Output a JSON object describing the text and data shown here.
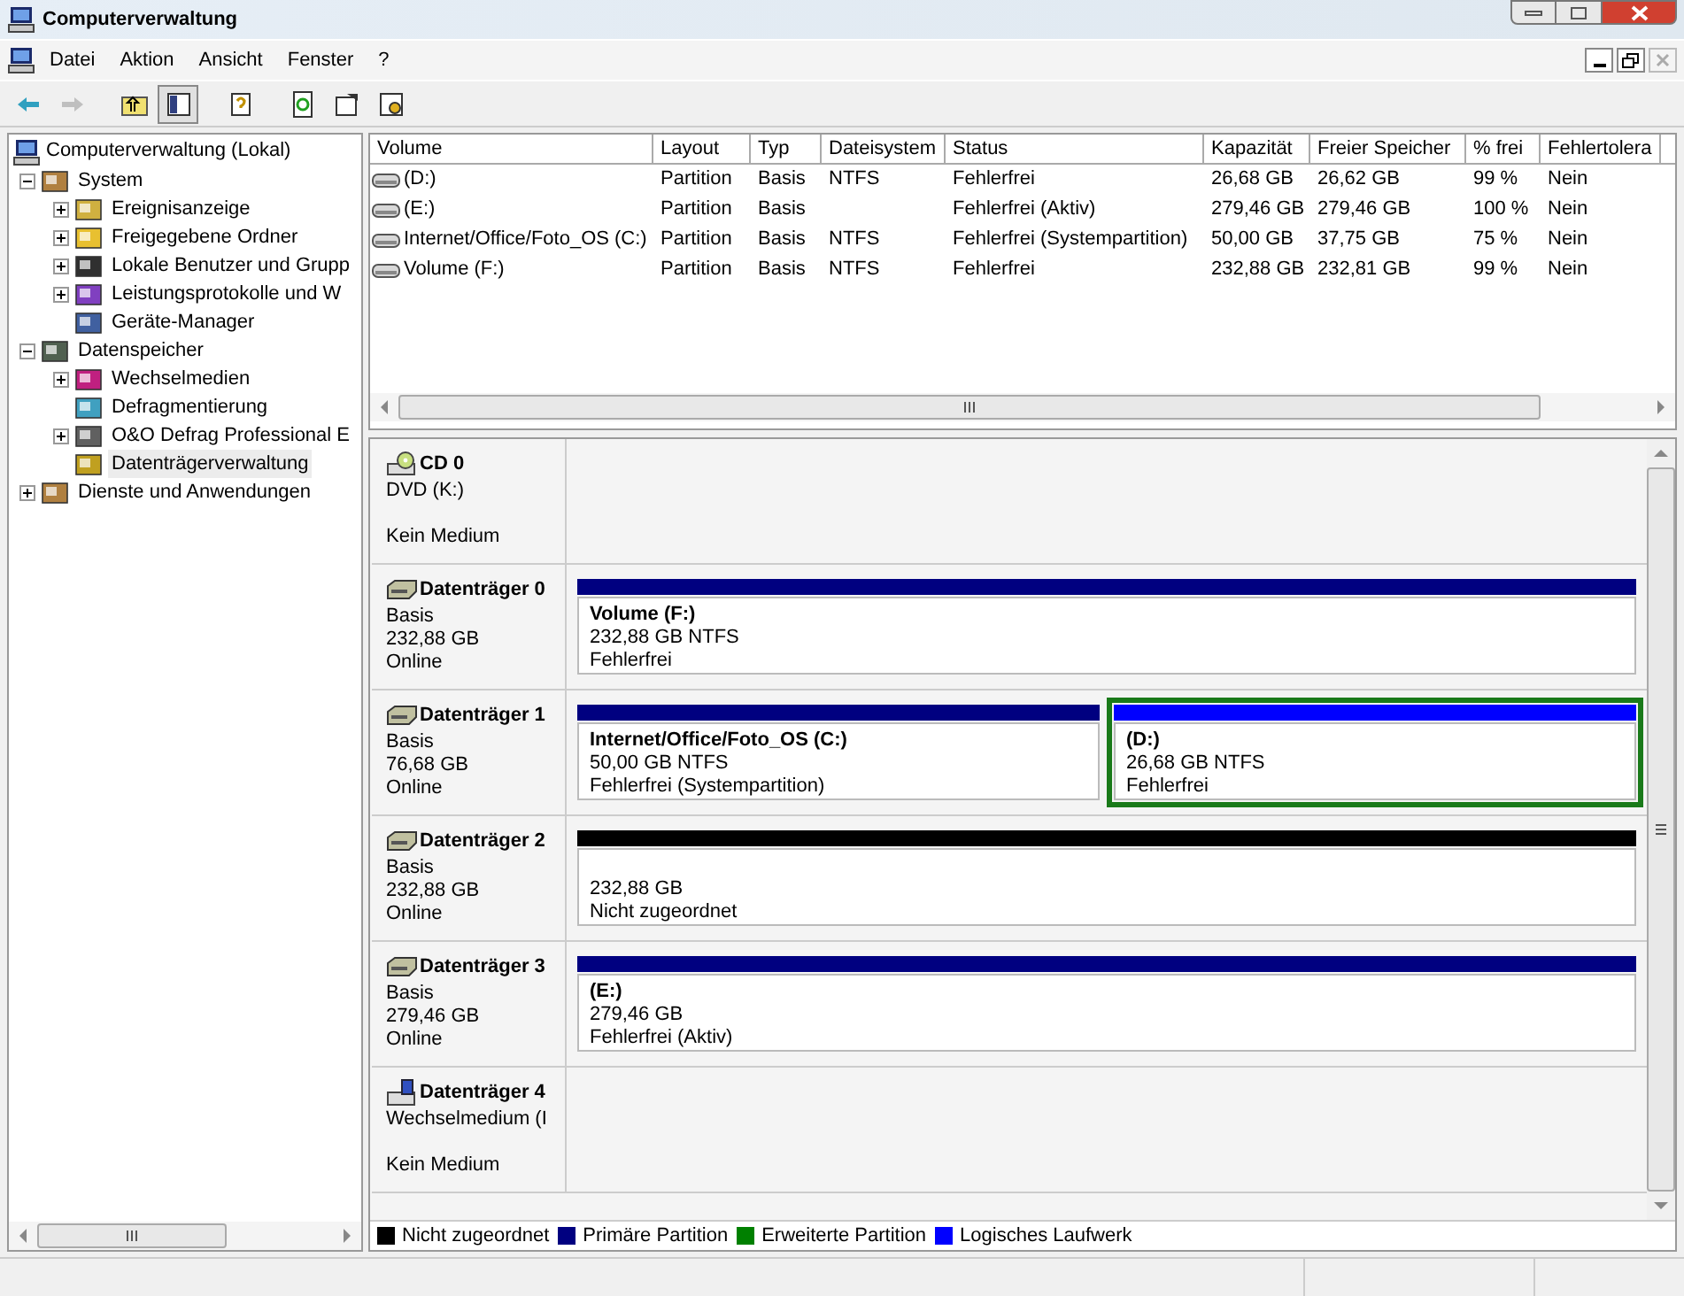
{
  "window": {
    "title": "Computerverwaltung"
  },
  "menu": [
    "Datei",
    "Aktion",
    "Ansicht",
    "Fenster",
    "?"
  ],
  "toolbar": [
    {
      "kind": "back",
      "disabled": false,
      "pressed": false
    },
    {
      "kind": "forward",
      "disabled": true,
      "pressed": false
    },
    {
      "kind": "up",
      "disabled": false,
      "pressed": false
    },
    {
      "kind": "tree",
      "disabled": false,
      "pressed": true
    },
    {
      "kind": "help",
      "disabled": false,
      "pressed": false
    },
    {
      "kind": "refresh",
      "disabled": false,
      "pressed": false
    },
    {
      "kind": "properties",
      "disabled": false,
      "pressed": false
    },
    {
      "kind": "settings",
      "disabled": false,
      "pressed": false
    }
  ],
  "tree": {
    "root": "Computerverwaltung (Lokal)",
    "items": [
      {
        "label": "System",
        "kind": "node",
        "expanded": true,
        "selected": false,
        "children": [
          {
            "label": "Ereignisanzeige",
            "kind": "node",
            "expanded": false,
            "selected": false
          },
          {
            "label": "Freigegebene Ordner",
            "kind": "node",
            "expanded": false,
            "selected": false
          },
          {
            "label": "Lokale Benutzer und Grupp",
            "kind": "node",
            "expanded": false,
            "selected": false
          },
          {
            "label": "Leistungsprotokolle und W",
            "kind": "node",
            "expanded": false,
            "selected": false
          },
          {
            "label": "Geräte-Manager",
            "kind": "leaf",
            "selected": false
          }
        ]
      },
      {
        "label": "Datenspeicher",
        "kind": "node",
        "expanded": true,
        "selected": false,
        "children": [
          {
            "label": "Wechselmedien",
            "kind": "node",
            "expanded": false,
            "selected": false
          },
          {
            "label": "Defragmentierung",
            "kind": "leaf",
            "selected": false
          },
          {
            "label": "O&O Defrag Professional E",
            "kind": "node",
            "expanded": false,
            "selected": false
          },
          {
            "label": "Datenträgerverwaltung",
            "kind": "leaf",
            "selected": true
          }
        ]
      },
      {
        "label": "Dienste und Anwendungen",
        "kind": "node",
        "expanded": false,
        "selected": false
      }
    ]
  },
  "table": {
    "columns": [
      "Volume",
      "Layout",
      "Typ",
      "Dateisystem",
      "Status",
      "Kapazität",
      "Freier Speicher",
      "% frei",
      "Fehlertolera"
    ],
    "rows": [
      [
        "(D:)",
        "Partition",
        "Basis",
        "NTFS",
        "Fehlerfrei",
        "26,68 GB",
        "26,62 GB",
        "99 %",
        "Nein"
      ],
      [
        "(E:)",
        "Partition",
        "Basis",
        "",
        "Fehlerfrei (Aktiv)",
        "279,46 GB",
        "279,46 GB",
        "100 %",
        "Nein"
      ],
      [
        "Internet/Office/Foto_OS (C:)",
        "Partition",
        "Basis",
        "NTFS",
        "Fehlerfrei (Systempartition)",
        "50,00 GB",
        "37,75 GB",
        "75 %",
        "Nein"
      ],
      [
        "Volume (F:)",
        "Partition",
        "Basis",
        "NTFS",
        "Fehlerfrei",
        "232,88 GB",
        "232,81 GB",
        "99 %",
        "Nein"
      ]
    ]
  },
  "disks": [
    {
      "kind": "cd",
      "name": "CD 0",
      "lines": [
        "DVD (K:)"
      ],
      "footer": "Kein Medium"
    },
    {
      "kind": "disk",
      "name": "Datenträger 0",
      "lines": [
        "Basis",
        "232,88 GB",
        "Online"
      ],
      "partitions": [
        {
          "color": "#000080",
          "selected": false,
          "name": "Volume  (F:)",
          "lines": [
            "232,88 GB NTFS",
            "Fehlerfrei"
          ]
        }
      ]
    },
    {
      "kind": "disk",
      "name": "Datenträger 1",
      "lines": [
        "Basis",
        "76,68 GB",
        "Online"
      ],
      "partitions": [
        {
          "color": "#000080",
          "selected": false,
          "name": "Internet/Office/Foto_OS  (C:)",
          "lines": [
            "50,00 GB NTFS",
            "Fehlerfrei (Systempartition)"
          ]
        },
        {
          "color": "#0000ff",
          "selected": true,
          "name": "(D:)",
          "lines": [
            "26,68 GB NTFS",
            "Fehlerfrei"
          ]
        }
      ]
    },
    {
      "kind": "disk",
      "name": "Datenträger 2",
      "lines": [
        "Basis",
        "232,88 GB",
        "Online"
      ],
      "partitions": [
        {
          "color": "#000000",
          "selected": false,
          "lines": [
            "232,88 GB",
            "Nicht zugeordnet"
          ]
        }
      ]
    },
    {
      "kind": "disk",
      "name": "Datenträger 3",
      "lines": [
        "Basis",
        "279,46 GB",
        "Online"
      ],
      "partitions": [
        {
          "color": "#000080",
          "selected": false,
          "name": "(E:)",
          "lines": [
            "279,46 GB",
            "Fehlerfrei (Aktiv)"
          ]
        }
      ]
    },
    {
      "kind": "removable",
      "name": "Datenträger 4",
      "lines": [
        "Wechselmedium (I"
      ],
      "footer": "Kein Medium"
    }
  ],
  "legend": [
    {
      "label": "Nicht zugeordnet",
      "color": "#000000"
    },
    {
      "label": "Primäre Partition",
      "color": "#000080"
    },
    {
      "label": "Erweiterte Partition",
      "color": "#008000"
    },
    {
      "label": "Logisches Laufwerk",
      "color": "#0000ff"
    }
  ]
}
